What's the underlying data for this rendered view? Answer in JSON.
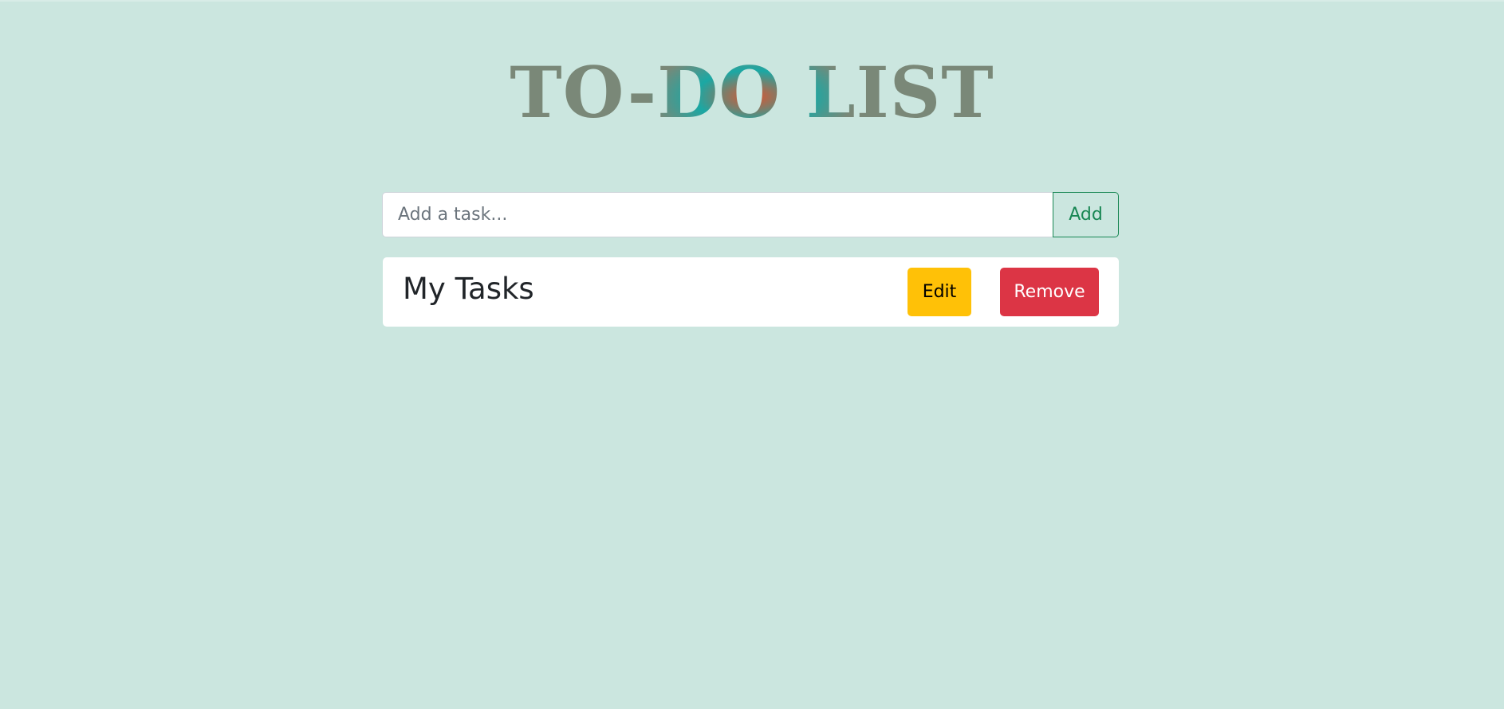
{
  "header": {
    "title": "TO-DO LIST"
  },
  "add_form": {
    "placeholder": "Add a task...",
    "value": "",
    "add_label": "Add"
  },
  "tasks": [
    {
      "name": "My Tasks",
      "edit_label": "Edit",
      "remove_label": "Remove"
    }
  ],
  "colors": {
    "background": "#cbe6df",
    "title_gradient": [
      "#7a8878",
      "#1aa8a4",
      "#e0532e"
    ],
    "add_button": "#198754",
    "edit_button": "#ffc107",
    "remove_button": "#dc3545"
  }
}
